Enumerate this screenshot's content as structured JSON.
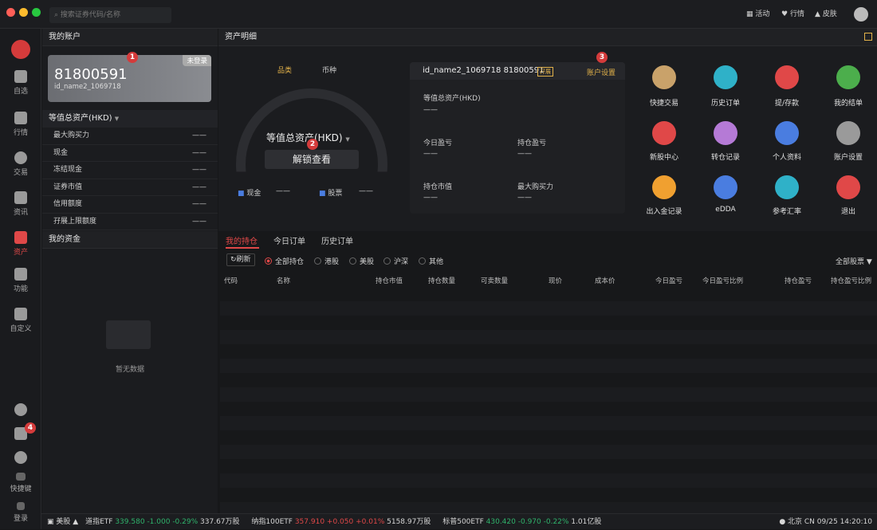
{
  "search": {
    "placeholder": "搜索证券代码/名称"
  },
  "topbar": {
    "activity": "活动",
    "quotes": "行情",
    "skin": "皮肤"
  },
  "nav": [
    {
      "label": "自选"
    },
    {
      "label": "行情"
    },
    {
      "label": "交易"
    },
    {
      "label": "资讯"
    },
    {
      "label": "资产"
    },
    {
      "label": "功能"
    },
    {
      "label": "自定义"
    }
  ],
  "nav_bottom": {
    "shortcut": "快捷键",
    "login": "登录",
    "msg_count": "4"
  },
  "account": {
    "title": "我的账户",
    "number": "81800591",
    "id": "id_name2_1069718",
    "status": "未登录",
    "total_label": "等值总资产(HKD)",
    "rows": [
      {
        "label": "最大购买力",
        "value": "——"
      },
      {
        "label": "现金",
        "value": "——"
      },
      {
        "label": "冻结现金",
        "value": "——"
      },
      {
        "label": "证券市值",
        "value": "——"
      },
      {
        "label": "信用额度",
        "value": "——"
      },
      {
        "label": "孖展上限额度",
        "value": "——"
      }
    ]
  },
  "funds": {
    "title": "我的资金",
    "empty": "暂无数据"
  },
  "detail": {
    "title": "资产明细",
    "tab1": "品类",
    "tab2": "币种",
    "gauge_label": "等值总资产(HKD)",
    "unlock": "解锁查看",
    "cash": "现金",
    "cash_val": "——",
    "stock": "股票",
    "stock_val": "——"
  },
  "info": {
    "account": "id_name2_1069718 81800591",
    "tag": "孖展",
    "settings": "账户设置",
    "total": "等值总资产(HKD)",
    "total_val": "——",
    "today_pl": "今日盈亏",
    "today_pl_val": "——",
    "hold_pl": "持仓盈亏",
    "hold_pl_val": "——",
    "mkt": "持仓市值",
    "mkt_val": "——",
    "bp": "最大购买力",
    "bp_val": "——"
  },
  "shortcuts": [
    {
      "label": "快捷交易",
      "color": "#c9a26a"
    },
    {
      "label": "历史订单",
      "color": "#2fb1c8"
    },
    {
      "label": "提/存款",
      "color": "#e04848"
    },
    {
      "label": "我的结单",
      "color": "#4cae4c"
    },
    {
      "label": "新股中心",
      "color": "#e04848"
    },
    {
      "label": "转仓记录",
      "color": "#b57ad6"
    },
    {
      "label": "个人资料",
      "color": "#4a7de0"
    },
    {
      "label": "账户设置",
      "color": "#9a9a9a"
    },
    {
      "label": "出入金记录",
      "color": "#f0a030"
    },
    {
      "label": "eDDA",
      "color": "#4a7de0"
    },
    {
      "label": "参考汇率",
      "color": "#2fb1c8"
    },
    {
      "label": "退出",
      "color": "#e04848"
    }
  ],
  "markers": [
    "1",
    "2",
    "3"
  ],
  "tabs": {
    "holdings": "我的持仓",
    "today": "今日订单",
    "history": "历史订单"
  },
  "filters": {
    "refresh": "刷新",
    "all": "全部持仓",
    "hk": "港股",
    "us": "美股",
    "sh": "沪深",
    "other": "其他",
    "all_stocks": "全部股票"
  },
  "columns": [
    "代码",
    "名称",
    "持仓市值",
    "持仓数量",
    "可卖数量",
    "现价",
    "成本价",
    "今日盈亏",
    "今日盈亏比例",
    "持仓盈亏",
    "持仓盈亏比例"
  ],
  "ticker": {
    "market": "美股",
    "s1_name": "道指ETF",
    "s1_price": "339.580",
    "s1_chg": "-1.000",
    "s1_pct": "-0.29%",
    "s1_vol": "337.67万股",
    "s2_name": "纳指100ETF",
    "s2_price": "357.910",
    "s2_chg": "+0.050",
    "s2_pct": "+0.01%",
    "s2_vol": "5158.97万股",
    "s3_name": "标普500ETF",
    "s3_price": "430.420",
    "s3_chg": "-0.970",
    "s3_pct": "-0.22%",
    "s3_vol": "1.01亿股",
    "status": "北京 CN 09/25 14:20:10"
  }
}
